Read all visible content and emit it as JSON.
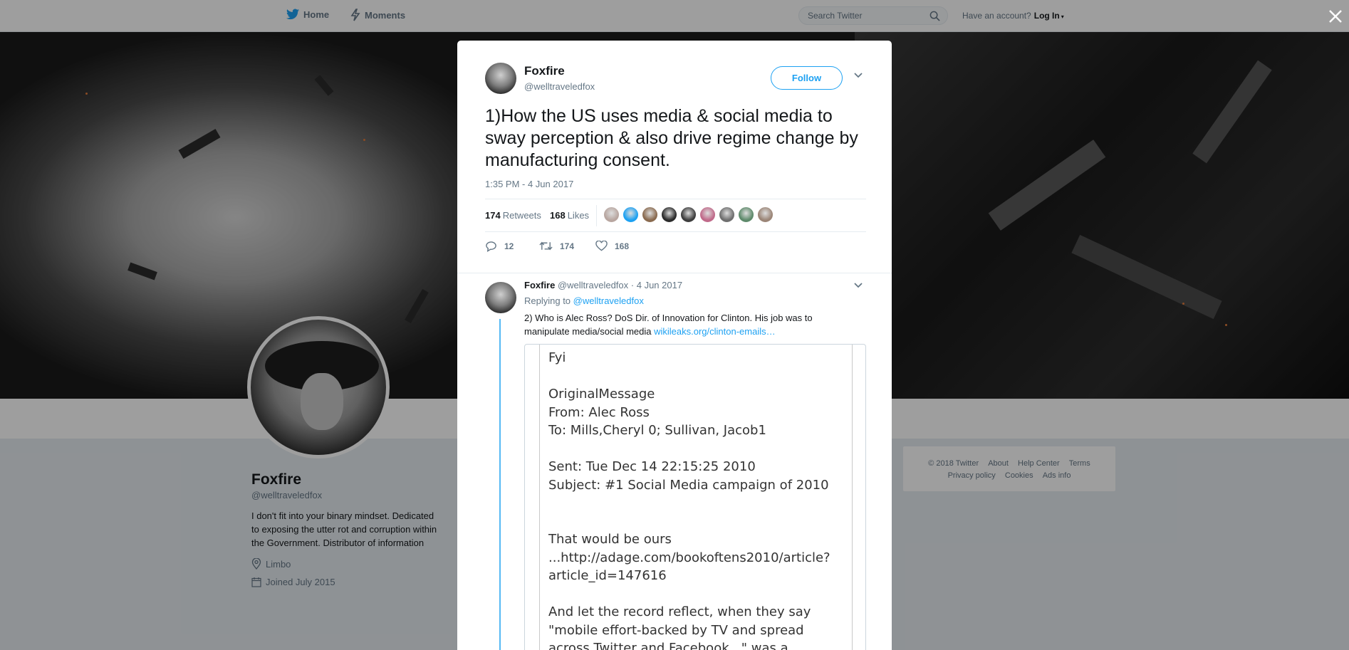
{
  "topnav": {
    "home_label": "Home",
    "moments_label": "Moments",
    "search_placeholder": "Search Twitter",
    "have_account": "Have an account?",
    "login_label": "Log In"
  },
  "profile": {
    "name": "Foxfire",
    "handle": "@welltraveledfox",
    "bio": "I don't fit into your binary mindset. Dedicated to exposing the utter rot and corruption within the Government. Distributor of information",
    "location": "Limbo",
    "joined": "Joined July 2015"
  },
  "footer": {
    "copyright": "© 2018 Twitter",
    "about": "About",
    "help": "Help Center",
    "terms": "Terms",
    "privacy": "Privacy policy",
    "cookies": "Cookies",
    "ads": "Ads info"
  },
  "tweet": {
    "name": "Foxfire",
    "handle": "@welltraveledfox",
    "follow_label": "Follow",
    "text": "1)How the US uses media & social media to sway perception & also drive regime change by manufacturing consent.",
    "time": "1:35 PM - 4 Jun 2017",
    "retweets_count": "174",
    "retweets_label": "Retweets",
    "likes_count": "168",
    "likes_label": "Likes",
    "likers_colors": [
      "#b8a6a0",
      "#1da1f2",
      "#8a6a4f",
      "#2b2b2b",
      "#3d3d3d",
      "#c06a8a",
      "#6f6f6f",
      "#5e8a6b",
      "#9b8577"
    ],
    "reply_count": "12",
    "retweet_action_count": "174",
    "like_action_count": "168"
  },
  "reply": {
    "name": "Foxfire",
    "handle": "@welltraveledfox",
    "date": "· 4 Jun 2017",
    "replying_prefix": "Replying to",
    "replying_to": "@welltraveledfox",
    "text": "2) Who is Alec Ross? DoS Dir. of Innovation for Clinton. His job was to manipulate media/social media",
    "link": "wikileaks.org/clinton-emails…",
    "doc_lines": [
      "Fyi",
      "",
      "OriginalMessage",
      "From: Alec Ross",
      "To: Mills,Cheryl 0; Sullivan, Jacob1",
      "",
      "Sent: Tue Dec 14 22:15:25 2010",
      "Subject: #1 Social Media campaign of 2010",
      "",
      "",
      "That would be ours",
      "...http://adage.com/bookoftens2010/article?",
      "article_id=147616",
      "",
      "And let the record reflect, when they say",
      "\"mobile effort-backed by TV and spread",
      "across Twitter and Facebook...\" was a"
    ]
  }
}
